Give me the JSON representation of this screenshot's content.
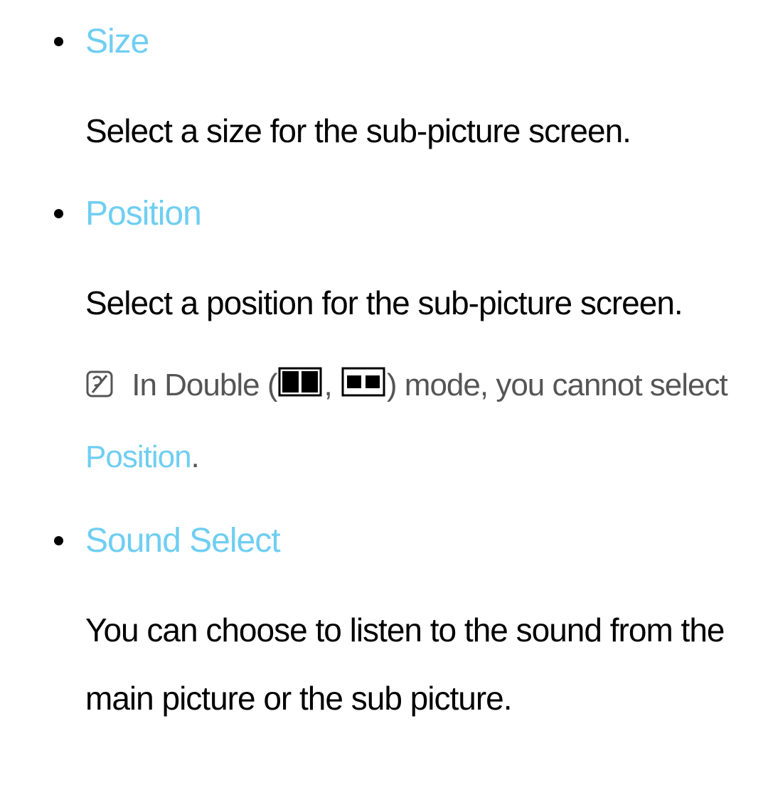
{
  "items": [
    {
      "title": "Size",
      "body": "Select a size for the sub-picture screen."
    },
    {
      "title": "Position",
      "body": "Select a position for the sub-picture screen.",
      "note_prefix": "In Double (",
      "note_mid": ", ",
      "note_after_icons": ") mode, you cannot select ",
      "note_link": "Position",
      "note_suffix": "."
    },
    {
      "title": "Sound Select",
      "body": "You can choose to listen to the sound from the main picture or the sub picture."
    }
  ]
}
